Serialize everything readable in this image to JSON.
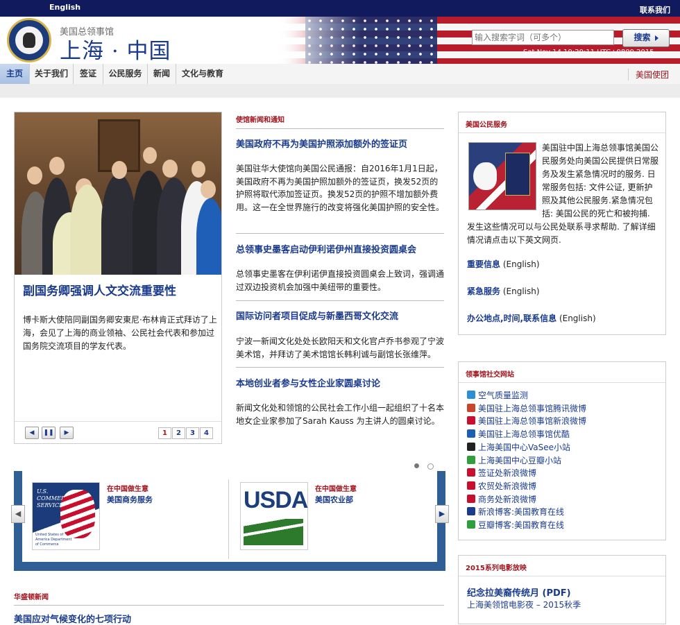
{
  "topbar": {
    "language_link": "English",
    "contact_link": "联系我们"
  },
  "header": {
    "subtitle": "美国总领事馆",
    "title": "上海 · 中国",
    "search_placeholder": "输入搜索字词（可多个）",
    "search_button": "搜索",
    "datetime": "Sat Nov 14 19:20:11 UTC+0800 2015"
  },
  "nav": {
    "items": [
      "主页",
      "关于我们",
      "签证",
      "公民服务",
      "新闻",
      "文化与教育"
    ],
    "right_link": "美国使团"
  },
  "feature": {
    "title": "副国务卿强调人文交流重要性",
    "text": "博卡斯大使陪同副国务卿安東尼·布林肯正式拜访了上海，会见了上海的商业领袖、公民社会代表和参加过国务院交流项目的学友代表。",
    "controls": {
      "prev": "◀",
      "pause": "❚❚",
      "next": "▶"
    },
    "pages": [
      "1",
      "2",
      "3",
      "4"
    ]
  },
  "news": {
    "section_label": "使馆新闻和通知",
    "items": [
      {
        "title": "美国政府不再为美国护照添加额外的签证页",
        "text": "美国驻华大使馆向美国公民通报：自2016年1月1日起，美国政府不再为美国护照加额外的签证页，换发52页的护照将取代添加签证页。换发52页的护照不增加额外费用。这一在全世界施行的改变将强化美国护照的安全性。"
      },
      {
        "title": "总领事史墨客启动伊利诺伊州直接投资圆桌会",
        "text": "总领事史墨客在伊利诺伊直接投资圆桌会上致词，强调通过双边投资机会加强中美纽带的重要性。"
      },
      {
        "title": "国际访问者项目促成与新墨西哥文化交流",
        "text": "宁波一新闻文化处处长欧阳天和文化官卢乔书参观了宁波美术馆，并拜访了美术馆馆长韩利诚与副馆长张维萍。"
      },
      {
        "title": "本地创业者参与女性企业家圆桌讨论",
        "text": "新闻文化处和领馆的公民社会工作小组一起组织了十名本地女企业家参加了Sarah Kauss 为主讲人的圆桌讨论。"
      }
    ]
  },
  "citizen_services": {
    "header": "美国公民服务",
    "text": "美国驻中国上海总领事馆美国公民服务处向美国公民提供日常服务及发生紧急情况时的服务. 日常服务包括: 文件公证, 更新护照及其他公民服务.紧急情况包括: 美国公民的死亡和被拘捕. 发生这些情况可以与公民处联系寻求帮助. 了解详细情况请点击以下英文网页.",
    "links": [
      {
        "label": "重要信息",
        "suffix": " (English)"
      },
      {
        "label": "紧急服务",
        "suffix": " (English)"
      },
      {
        "label": "办公地点,时间,联系信息",
        "suffix": " (English)"
      }
    ]
  },
  "social": {
    "header": "领事馆社交网站",
    "items": [
      {
        "label": "空气质量监测",
        "icon": "air-quality-icon",
        "color": "#2a8fd8"
      },
      {
        "label": "美国驻上海总领事馆腾讯微博",
        "icon": "tencent-weibo-icon",
        "color": "#c9462c"
      },
      {
        "label": "美国驻上海总领事馆新浪微博",
        "icon": "sina-weibo-icon",
        "color": "#c8102e"
      },
      {
        "label": "美国驻上海总领事馆优酷",
        "icon": "youku-icon",
        "color": "#1a5fb4"
      },
      {
        "label": "上海美国中心VaSee小站",
        "icon": "vasee-icon",
        "color": "#222222"
      },
      {
        "label": "上海美国中心豆瓣小站",
        "icon": "douban-icon",
        "color": "#2e9f3c"
      },
      {
        "label": "签证处新浪微博",
        "icon": "visa-weibo-icon",
        "color": "#c8102e"
      },
      {
        "label": "农贸处新浪微博",
        "icon": "ag-weibo-icon",
        "color": "#c8102e"
      },
      {
        "label": "商务处新浪微博",
        "icon": "commerce-weibo-icon",
        "color": "#c8102e"
      },
      {
        "label": "新浪博客:美国教育在线",
        "icon": "sina-blog-icon",
        "color": "#1a3b8c"
      },
      {
        "label": "豆瓣博客:美国教育在线",
        "icon": "douban-blog-icon",
        "color": "#2e9f3c"
      }
    ]
  },
  "film": {
    "header": "2015系列电影放映",
    "link1": "纪念拉美裔传统月 (PDF)",
    "link2": "上海美领馆电影夜 – 2015秋季"
  },
  "carousel": {
    "cards": [
      {
        "label": "在中国做生意",
        "link": "美国商务服务",
        "logo": "U.S. COMMERCIAL SERVICE",
        "logo_sub": "United States of America Department of Commerce"
      },
      {
        "label": "在中国做生意",
        "link": "美国农业部",
        "logo": "USDA"
      }
    ]
  },
  "washington": {
    "section_label": "华盛顿新闻",
    "first_item": "美国应对气候变化的七项行动"
  },
  "colors": {
    "navy": "#101a5c",
    "link_blue": "#1a3b8c",
    "section_red": "#a0121c",
    "carousel_blue": "#2f5f94"
  }
}
